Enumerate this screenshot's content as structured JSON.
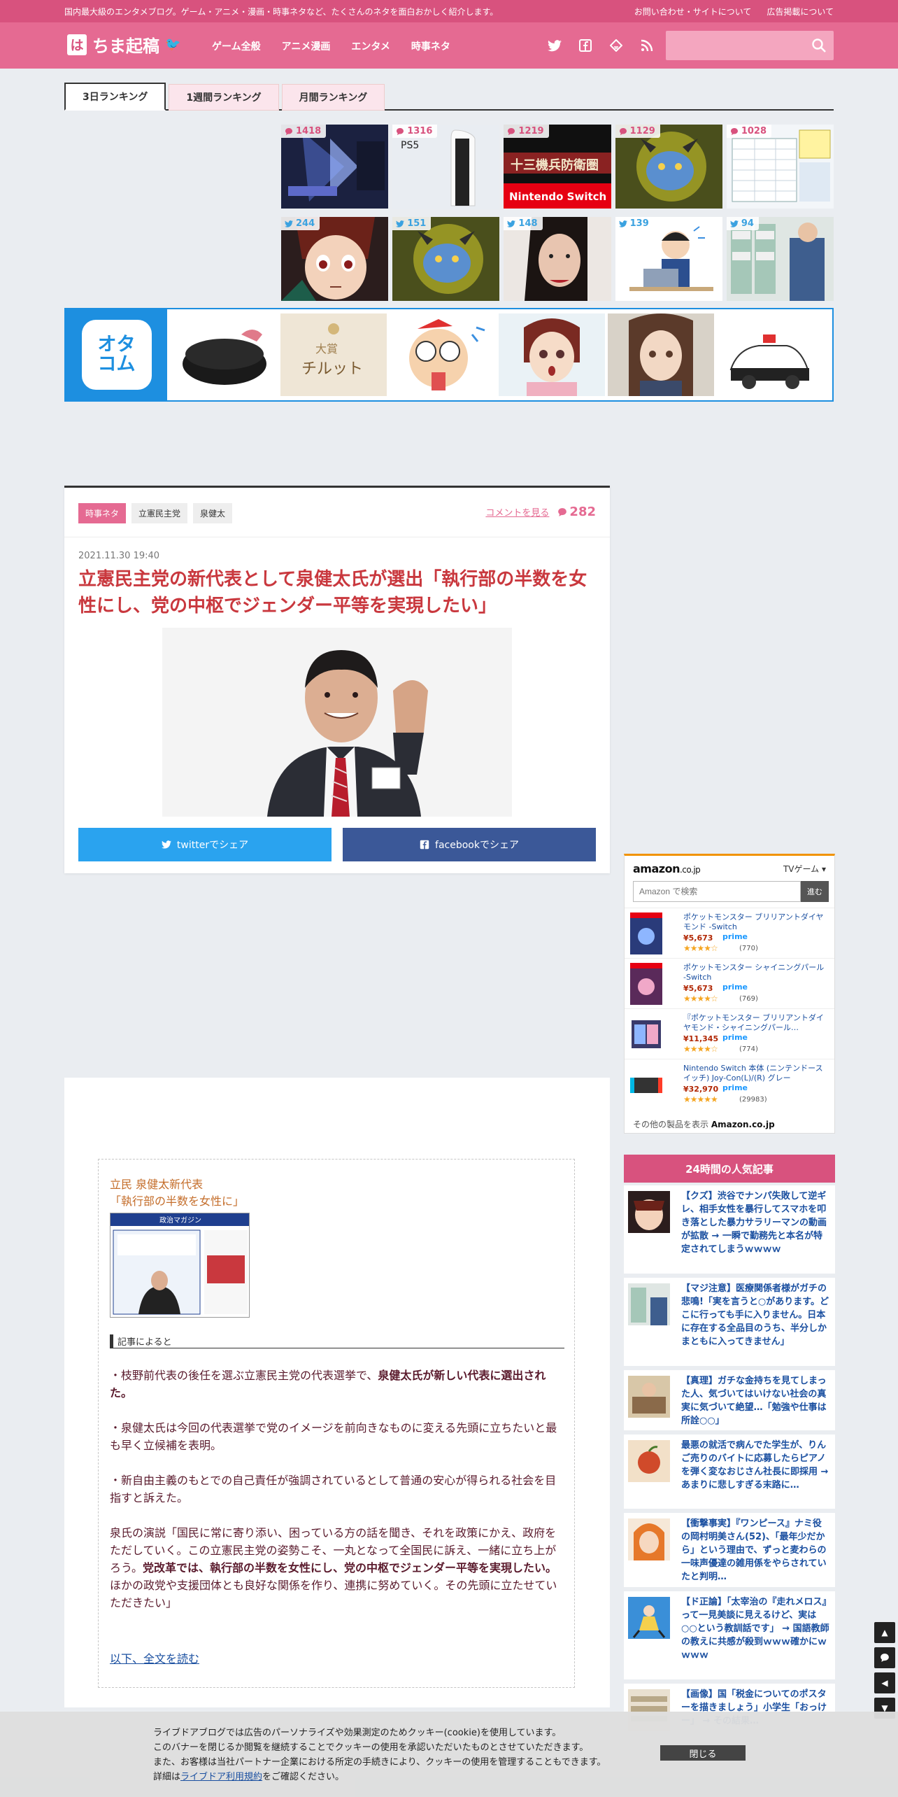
{
  "topbar": {
    "tagline": "国内最大級のエンタメブログ。ゲーム・アニメ・漫画・時事ネタなど、たくさんのネタを面白おかしく紹介します。",
    "links": [
      "お問い合わせ・サイトについて",
      "広告掲載について"
    ]
  },
  "header": {
    "logo_mark": "は",
    "logo_text": "ちま起稿",
    "nav": [
      "ゲーム全般",
      "アニメ漫画",
      "エンタメ",
      "時事ネタ"
    ],
    "social_icons": [
      "twitter-icon",
      "facebook-icon",
      "feedly-icon",
      "rss-icon"
    ],
    "search_placeholder": ""
  },
  "ranking": {
    "tabs": [
      "3日ランキング",
      "1週間ランキング",
      "月間ランキング"
    ],
    "active_tab": 0,
    "comment_row": [
      {
        "count": "1418"
      },
      {
        "count": "1316"
      },
      {
        "count": "1219"
      },
      {
        "count": "1129"
      },
      {
        "count": "1028"
      }
    ],
    "twitter_row": [
      {
        "count": "244"
      },
      {
        "count": "151"
      },
      {
        "count": "148"
      },
      {
        "count": "139"
      },
      {
        "count": "94"
      }
    ]
  },
  "otacom": {
    "brand_line1": "オタ",
    "brand_line2": "コム"
  },
  "article": {
    "category": "時事ネタ",
    "tags": [
      "立憲民主党",
      "泉健太"
    ],
    "comment_link_label": "コメントを見る",
    "comment_count": "282",
    "date": "2021.11.30 19:40",
    "title": "立憲民主党の新代表として泉健太氏が選出「執行部の半数を女性にし、党の中枢でジェンダー平等を実現したい」",
    "share_twitter": "twitterでシェア",
    "share_facebook": "facebookでシェア"
  },
  "amazon": {
    "logo": "amazon",
    "logo_suffix": ".co.jp",
    "category": "TVゲーム",
    "search_placeholder": "Amazon で検索",
    "search_button": "進む",
    "products": [
      {
        "name": "ポケットモンスター ブリリアントダイヤモンド -Switch",
        "price": "¥5,673",
        "prime": "prime",
        "stars": "★★★★☆",
        "reviews": "(770)"
      },
      {
        "name": "ポケットモンスター シャイニングパール -Switch",
        "price": "¥5,673",
        "prime": "prime",
        "stars": "★★★★☆",
        "reviews": "(769)"
      },
      {
        "name": "『ポケットモンスター ブリリアントダイヤモンド・シャイニングパール…",
        "price": "¥11,345",
        "prime": "prime",
        "stars": "★★★★☆",
        "reviews": "(774)"
      },
      {
        "name": "Nintendo Switch 本体 (ニンテンドースイッチ) Joy-Con(L)/(R) グレー",
        "price": "¥32,970",
        "prime": "prime",
        "stars": "★★★★★",
        "reviews": "(29983)"
      }
    ],
    "more_label": "その他の製品を表示",
    "more_site": "Amazon.co.jp"
  },
  "popular": {
    "heading": "24時間の人気記事",
    "items": [
      {
        "title": "【クズ】渋谷でナンパ失敗して逆ギレ、相手女性を暴行してスマホを叩き落とした暴力サラリーマンの動画が拡散 → 一瞬で勤務先と本名が特定されてしまうｗｗｗｗ"
      },
      {
        "title": "【マジ注意】医療関係者様がガチの悲鳴!「実を言うと○があります。どこに行っても手に入りません。日本に存在する全品目のうち、半分しかまともに入ってきません」"
      },
      {
        "title": "【真理】ガチな金持ちを見てしまった人、気づいてはいけない社会の真実に気づいて絶望…「勉強や仕事は所詮○○」"
      },
      {
        "title": "最悪の就活で病んでた学生が、りんご売りのバイトに応募したらピアノを弾く変なおじさん社長に即採用 → あまりに悲しすぎる末路に…"
      },
      {
        "title": "【衝撃事実】『ワンピース』ナミ役の岡村明美さん(52)、「最年少だから」という理由で、ずっと麦わらの一味声優達の雑用係をやらされていたと判明…"
      },
      {
        "title": "【ド正論】「太宰治の『走れメロス』って一見美談に見えるけど、実は○○という教訓話です」 → 国語教師の教えに共感が殺到ｗｗｗ確かにｗｗｗｗ"
      },
      {
        "title": "【画像】国「税金についてのポスターを描きましょう」小学生「おっけー」 → その結果…"
      }
    ]
  },
  "quote": {
    "source_line1": "立民 泉健太新代表",
    "source_line2": "「執行部の半数を女性に」",
    "thumb_title": "政治マガジン",
    "heading": "記事によると",
    "para1_normal": "・枝野前代表の後任を選ぶ立憲民主党の代表選挙で、",
    "para1_bold": "泉健太氏が新しい代表に選出された。",
    "para2": "・泉健太氏は今回の代表選挙で党のイメージを前向きなものに変える先頭に立ちたいと最も早く立候補を表明。",
    "para3": "・新自由主義のもとでの自己責任が強調されているとして普通の安心が得られる社会を目指すと訴えた。",
    "para4_normal_a": "泉氏の演説「国民に常に寄り添い、困っている方の話を聞き、それを政策にかえ、政府をただしていく。この立憲民主党の姿勢こそ、一丸となって全国民に訴え、一緒に立ち上がろう。",
    "para4_bold": "党改革では、執行部の半数を女性にし、党の中枢でジェンダー平等を実現したい。",
    "para4_normal_b": "ほかの政党や支援団体とも良好な関係を作り、連携に努めていく。その先頭に立たせていただきたい」",
    "read_more": "以下、全文を読む"
  },
  "cookie": {
    "line1": "ライブドアブログでは広告のパーソナライズや効果測定のためクッキー(cookie)を使用しています。",
    "line2": "このバナーを閉じるか閲覧を継続することでクッキーの使用を承認いただいたものとさせていただきます。",
    "line3": "また、お客様は当社パートナー企業における所定の手続きにより、クッキーの使用を管理することもできます。",
    "line4_pre": "詳細は",
    "line4_link": "ライブドア利用規約",
    "line4_post": "をご確認ください。",
    "close": "閉じる"
  },
  "floating": {
    "buttons": [
      "arrow-up-icon",
      "comment-icon",
      "arrow-left-icon",
      "arrow-down-icon"
    ]
  }
}
